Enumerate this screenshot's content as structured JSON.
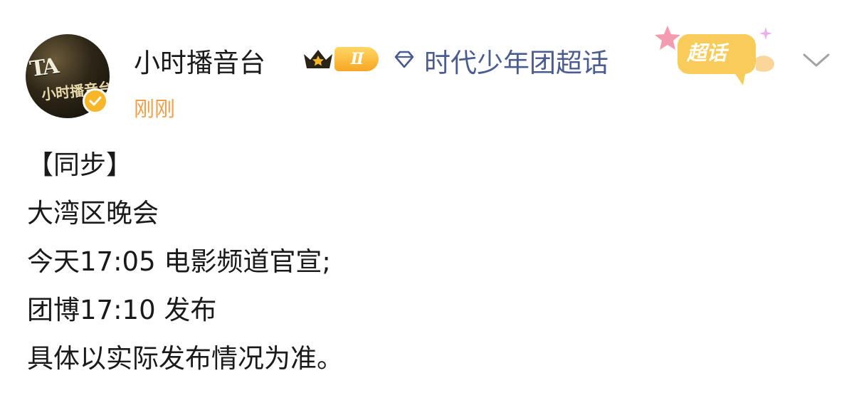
{
  "post": {
    "username": "小时播音台",
    "level_badge": "II",
    "topic": "时代少年团超话",
    "supertopic_tag": "超话",
    "timestamp": "刚刚",
    "avatar_text": "TA",
    "avatar_subtext": "小时播音台",
    "body_lines": [
      "【同步】",
      "大湾区晚会",
      "今天17:05 电影频道官宣;",
      "团博17:10 发布",
      "具体以实际发布情况为准。"
    ]
  },
  "icons": {
    "crown": "crown-icon",
    "diamond": "diamond-icon",
    "verify": "verified-badge-icon",
    "chevron": "chevron-down-icon",
    "star": "star-icon"
  },
  "colors": {
    "username": "#1a1a1a",
    "topic_link": "#4b5c8e",
    "timestamp": "#f0a04a",
    "badge_gold": "#f7a623",
    "verify": "#f7b52a"
  }
}
